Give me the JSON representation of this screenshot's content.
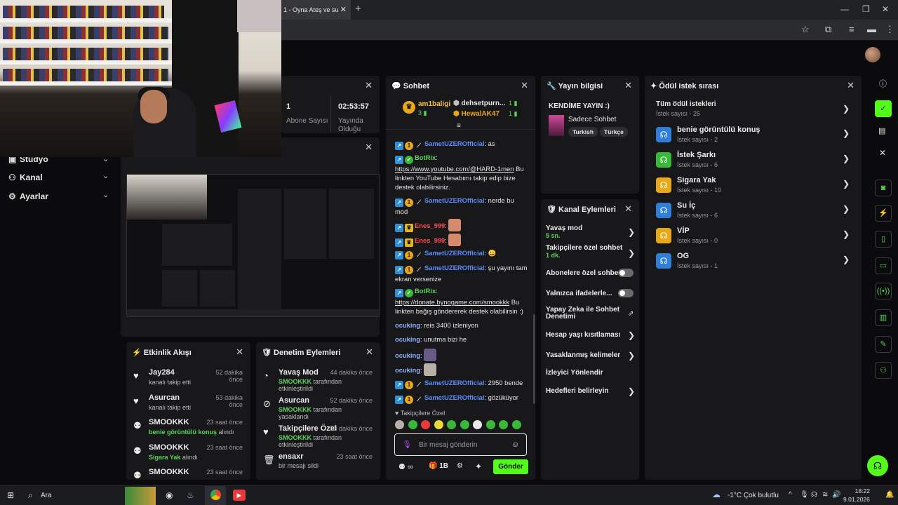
{
  "browser": {
    "tab_title": "1 - Oyna Ateş ve su",
    "new_tab": "+",
    "win_min": "—",
    "win_max": "❐",
    "win_close": "✕"
  },
  "sidebar": {
    "items": [
      {
        "label": "Stüdyo",
        "icon": "video-icon"
      },
      {
        "label": "Kanal",
        "icon": "users-icon"
      },
      {
        "label": "Ayarlar",
        "icon": "gear-icon"
      }
    ]
  },
  "stats": {
    "abone_value": "1",
    "abone_label": "Abone Sayısı",
    "time_value": "02:53:57",
    "time_label": "Yayında Olduğu"
  },
  "activity": {
    "title": "Etkinlik Akışı",
    "items": [
      {
        "name": "Jay284",
        "time": "52 dakika önce",
        "pre": "",
        "hl": "",
        "post": "kanalı takip etti",
        "icon": "heart-icon"
      },
      {
        "name": "Asurcan",
        "time": "53 dakika önce",
        "pre": "",
        "hl": "",
        "post": "kanalı takip etti",
        "icon": "heart-icon"
      },
      {
        "name": "SMOOKKK",
        "time": "23 saat önce",
        "pre": "",
        "hl": "benie görüntülü konuş",
        "post": " alındı",
        "icon": "reward-icon"
      },
      {
        "name": "SMOOKKK",
        "time": "23 saat önce",
        "pre": "",
        "hl": "Sigara Yak",
        "post": " alındı",
        "icon": "reward-icon"
      },
      {
        "name": "SMOOKKK",
        "time": "23 saat önce",
        "pre": "",
        "hl": "",
        "post": "",
        "icon": "reward-icon"
      }
    ]
  },
  "moderation": {
    "title": "Denetim Eylemleri",
    "items": [
      {
        "name": "Yavaş Mod",
        "time": "44 dakika önce",
        "hl": "SMOOKKK",
        "post": " tarafından etkinleştirildi",
        "icon": "slow-icon"
      },
      {
        "name": "Asurcan",
        "time": "52 dakika önce",
        "hl": "SMOOKKK",
        "post": " tarafından yasaklandı",
        "icon": "ban-icon"
      },
      {
        "name": "Takipçilere Özel",
        "time": "53 dakika önce",
        "hl": "SMOOKKK",
        "post": " tarafından etkinleştirildi",
        "icon": "heart-icon"
      },
      {
        "name": "ensaxr",
        "time": "23 saat önce",
        "hl": "",
        "post": "bir mesajı sildi",
        "icon": "trash-icon"
      }
    ]
  },
  "chat": {
    "title": "Sohbet",
    "top_users": [
      {
        "name": "am1baligi",
        "count": "3"
      },
      {
        "name": "dehsetpurn...",
        "count": "1"
      },
      {
        "name": "HewalAK47",
        "count": "1"
      }
    ],
    "messages": [
      {
        "user": "SametUZEROfficial",
        "text": ": as"
      },
      {
        "user": "BotRix",
        "text": ":",
        "link": "https://www.youtube.com/@HARD-1men",
        "after": " Bu linkten YouTube Hesabımı takip edip bize destek olabilirsiniz."
      },
      {
        "user": "SametUZEROfficial",
        "text": ": nerde bu mod"
      },
      {
        "user": "Enes_999",
        "text": ":"
      },
      {
        "user": "Enes_999",
        "text": ":"
      },
      {
        "user": "SametUZEROfficial",
        "text": ": 😀"
      },
      {
        "user": "SametUZEROfficial",
        "text": ": şu yayını tam ekran versenize"
      },
      {
        "user": "BotRix",
        "text": ":",
        "link": "https://donate.bynogame.com/smookkk",
        "after": " Bu linkten bağış göndererek destek olabilirsin :)"
      },
      {
        "user": "ocuking",
        "text": ": reis 3400 izleniyon"
      },
      {
        "user": "ocuking",
        "text": ": unutma bizi he"
      },
      {
        "user": "ocuking",
        "text": ":"
      },
      {
        "user": "ocuking",
        "text": ":"
      },
      {
        "user": "SametUZEROfficial",
        "text": ": 2950 bende"
      },
      {
        "user": "SametUZEROfficial",
        "text": ": gözüküyor"
      }
    ],
    "followers_only": "Takipçilere Özel",
    "input_placeholder": "Bir mesaj gönderin",
    "infinite": "∞",
    "bits": "1B",
    "send": "Gönder"
  },
  "stream_info": {
    "title": "Yayın bilgisi",
    "stream_title": "KENDİME YAYIN :)",
    "category": "Sadece Sohbet",
    "tags": [
      "Turkish",
      "Türkçe"
    ]
  },
  "channel_actions": {
    "title": "Kanal Eylemleri",
    "slow_mode": "Yavaş mod",
    "slow_mode_val": "5 sn.",
    "followers_chat": "Takipçilere özel sohbet",
    "followers_chat_val": "1 dk.",
    "subs_chat": "Abonelere özel sohbet",
    "emotes_only": "Yalnızca ifadelerle...",
    "ai_moderation": "Yapay Zeka ile Sohbet Denetimi",
    "account_age": "Hesap yaşı kısıtlaması",
    "banned_words": "Yasaklanmış kelimeler",
    "raid": "İzleyici Yönlendir",
    "goals": "Hedefleri belirleyin"
  },
  "rewards": {
    "title": "Ödül istek sırası",
    "all": "Tüm ödül istekleri",
    "all_count": "İstek sayısı - 25",
    "items": [
      {
        "name": "benie görüntülü konuş",
        "count": "İstek sayısı - 2",
        "color": "#2f7fd8"
      },
      {
        "name": "İstek Şarkı",
        "count": "İstek sayısı - 6",
        "color": "#3ab83a"
      },
      {
        "name": "Sigara Yak",
        "count": "İstek sayısı - 10",
        "color": "#e8a81a"
      },
      {
        "name": "Su İç",
        "count": "İstek sayısı - 6",
        "color": "#2f7fd8"
      },
      {
        "name": "VİP",
        "count": "İstek sayısı - 0",
        "color": "#e8a81a"
      },
      {
        "name": "OG",
        "count": "İstek sayısı - 1",
        "color": "#2f7fd8"
      }
    ]
  },
  "taskbar": {
    "search": "Ara",
    "weather": "-1°C  Çok bulutlu",
    "time": "18:22",
    "date": "9.01.2026"
  },
  "colors": {
    "accent": "#53fc18",
    "panel": "#18181b",
    "background": "#0b0b0d"
  }
}
